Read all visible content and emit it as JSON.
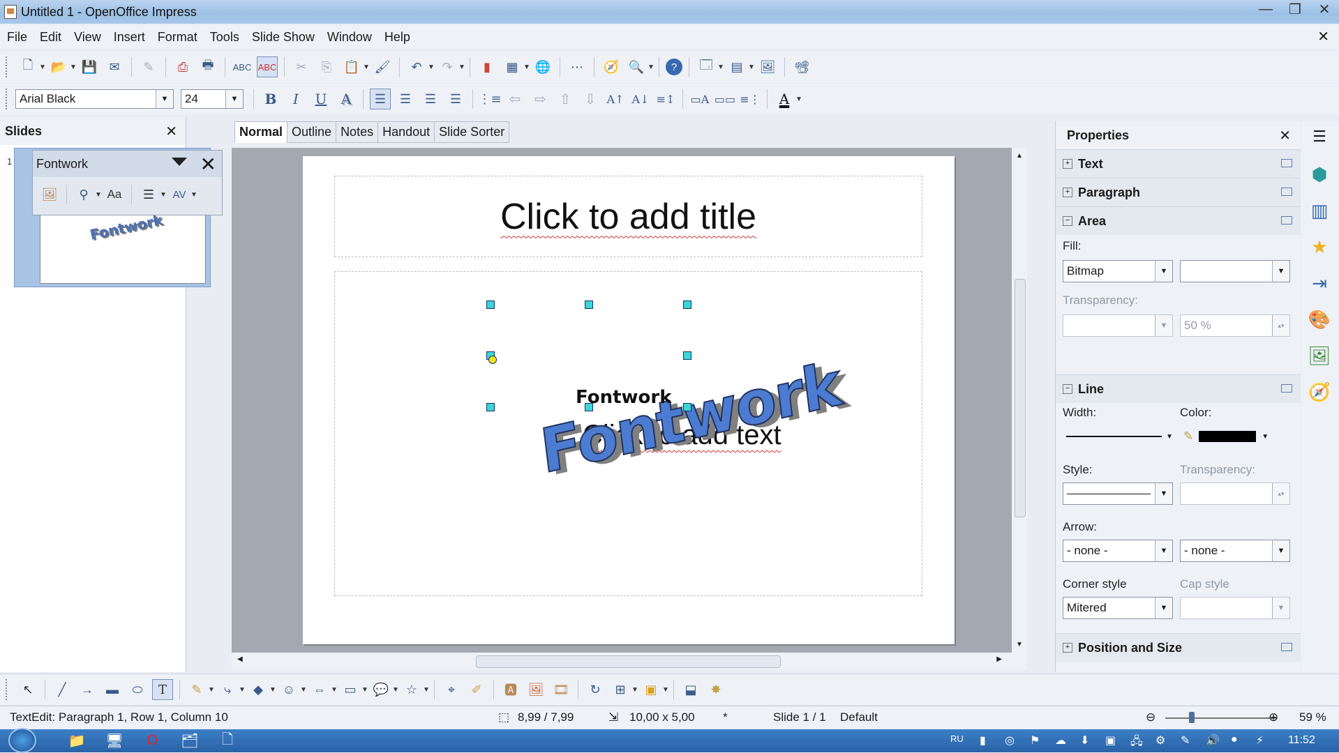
{
  "window": {
    "title": "Untitled 1 - OpenOffice Impress",
    "controls": [
      "—",
      "❐",
      "✕"
    ]
  },
  "menu": [
    "File",
    "Edit",
    "View",
    "Insert",
    "Format",
    "Tools",
    "Slide Show",
    "Window",
    "Help"
  ],
  "format_bar": {
    "font_name": "Arial Black",
    "font_size": "24",
    "bold": "B",
    "italic": "I",
    "underline": "U",
    "shadow": "A"
  },
  "slides_pane": {
    "title": "Slides",
    "close": "✕",
    "slide_number": "1",
    "thumb_text": "Fontwork"
  },
  "fontwork_toolbar": {
    "title": "Fontwork",
    "close": "✕",
    "case_label": "Aa"
  },
  "view_tabs": [
    "Normal",
    "Outline",
    "Notes",
    "Handout",
    "Slide Sorter"
  ],
  "slide": {
    "title_placeholder": "Click to add title",
    "body_placeholder": "Click to add text",
    "fontwork_art": "Fontwork",
    "fontwork_text": "Fontwork"
  },
  "properties": {
    "title": "Properties",
    "close": "✕",
    "sections": {
      "text": "Text",
      "paragraph": "Paragraph",
      "area": "Area",
      "line": "Line",
      "position": "Position and Size"
    },
    "area": {
      "fill_label": "Fill:",
      "fill_value": "Bitmap",
      "fill_secondary": "",
      "transparency_label": "Transparency:",
      "transparency_mode": "",
      "transparency_value": "50 %"
    },
    "line": {
      "width_label": "Width:",
      "color_label": "Color:",
      "style_label": "Style:",
      "transparency_label": "Transparency:",
      "arrow_label": "Arrow:",
      "arrow_start": "- none -",
      "arrow_end": "- none -",
      "corner_label": "Corner style",
      "corner_value": "Mitered",
      "cap_label": "Cap style",
      "cap_value": ""
    }
  },
  "status": {
    "edit_info": "TextEdit: Paragraph 1, Row 1, Column 10",
    "position": "8,99 / 7,99",
    "size": "10,00 x 5,00",
    "modified": "*",
    "slide": "Slide 1 / 1",
    "layout": "Default",
    "zoom": "59 %",
    "zoom_minus": "⊖",
    "zoom_plus": "⊕"
  },
  "taskbar": {
    "language": "RU",
    "clock": "11:52"
  }
}
